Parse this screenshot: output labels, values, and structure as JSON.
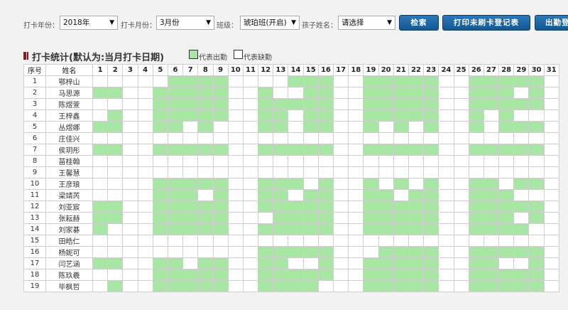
{
  "filters": {
    "year_label": "打卡年份：",
    "year_value": "2018年",
    "month_label": "打卡月份：",
    "month_value": "3月份",
    "class_label": "班级：",
    "class_value": "琥珀班(开启)",
    "child_label": "孩子姓名：",
    "child_value": "请选择",
    "search_button": "检索",
    "print_button": "打印未刷卡登记表",
    "export_button": "出勤登记"
  },
  "section": {
    "title": "打卡统计(默认为:当月打卡日期)",
    "legend_present": "代表出勤",
    "legend_absent": "代表缺勤",
    "colors": {
      "present": "#a8e6a3",
      "absent": "#ffffff",
      "title_mark": "#8b1a1a",
      "button": "#1e6aa8"
    }
  },
  "table": {
    "seq_header": "序号",
    "name_header": "姓名",
    "days": [
      "1",
      "2",
      "3",
      "4",
      "5",
      "6",
      "7",
      "8",
      "9",
      "10",
      "11",
      "12",
      "13",
      "14",
      "15",
      "16",
      "17",
      "18",
      "19",
      "20",
      "21",
      "22",
      "23",
      "24",
      "25",
      "26",
      "27",
      "28",
      "29",
      "30",
      "31"
    ],
    "rows": [
      {
        "seq": "1",
        "name": "鄂梓山",
        "present": [
          6,
          7,
          8,
          9,
          14,
          15,
          16,
          19,
          20,
          21,
          22,
          23,
          26,
          27,
          28,
          29,
          30
        ]
      },
      {
        "seq": "2",
        "name": "马思源",
        "present": [
          1,
          2,
          5,
          6,
          7,
          8,
          9,
          12,
          15,
          16,
          19,
          20,
          21,
          22,
          23,
          26,
          27,
          28,
          30
        ]
      },
      {
        "seq": "3",
        "name": "陈煜萱",
        "present": [
          5,
          6,
          7,
          8,
          9,
          12,
          13,
          14,
          15,
          16,
          19,
          20,
          21,
          22,
          23,
          26,
          27,
          28,
          29,
          30
        ]
      },
      {
        "seq": "4",
        "name": "王梓鑫",
        "present": [
          2,
          5,
          6,
          7,
          8,
          9,
          12,
          13,
          15,
          16,
          19,
          20,
          21,
          22,
          23,
          26,
          28
        ]
      },
      {
        "seq": "5",
        "name": "丛煜娜",
        "present": [
          1,
          2,
          5,
          6,
          8,
          12,
          13,
          15,
          16,
          19,
          21,
          23,
          26,
          28,
          29,
          30
        ]
      },
      {
        "seq": "6",
        "name": "庄佳兴",
        "present": []
      },
      {
        "seq": "7",
        "name": "侯玥彤",
        "present": [
          1,
          2,
          5,
          6,
          7,
          8,
          9,
          12,
          13,
          14,
          15,
          16,
          19,
          20,
          21,
          22,
          23,
          26,
          27,
          28,
          29,
          30
        ]
      },
      {
        "seq": "8",
        "name": "苗桂翰",
        "present": []
      },
      {
        "seq": "9",
        "name": "王馨慧",
        "present": []
      },
      {
        "seq": "10",
        "name": "王彦琅",
        "present": [
          5,
          6,
          7,
          8,
          9,
          12,
          13,
          14,
          16,
          19,
          21,
          23,
          26,
          27,
          29,
          30
        ]
      },
      {
        "seq": "11",
        "name": "梁靖芮",
        "present": [
          5,
          6,
          7,
          9,
          12,
          13,
          15,
          16,
          19,
          20,
          22,
          23,
          26,
          27,
          28
        ]
      },
      {
        "seq": "12",
        "name": "刘亚宸",
        "present": [
          1,
          2,
          5,
          6,
          7,
          8,
          9,
          12,
          13,
          14,
          15,
          16,
          19,
          20,
          21,
          22,
          23,
          26,
          27,
          28,
          29,
          30
        ]
      },
      {
        "seq": "13",
        "name": "张耘赫",
        "present": [
          1,
          2,
          5,
          6,
          7,
          8,
          9,
          13,
          14,
          15,
          16,
          19,
          20,
          21,
          22,
          23,
          26,
          27,
          28,
          30
        ]
      },
      {
        "seq": "14",
        "name": "刘家碁",
        "present": [
          1,
          5,
          6,
          7,
          8,
          9,
          12,
          13,
          14,
          15,
          16,
          19,
          20,
          21,
          22,
          23,
          26,
          27,
          28,
          29
        ]
      },
      {
        "seq": "15",
        "name": "田皓仁",
        "present": []
      },
      {
        "seq": "16",
        "name": "杨妮可",
        "present": [
          12,
          13,
          14,
          15,
          16,
          20,
          21,
          22,
          23,
          26,
          27,
          28,
          29,
          30
        ]
      },
      {
        "seq": "17",
        "name": "闫艺涵",
        "present": [
          1,
          2,
          5,
          6,
          8,
          9,
          12,
          13,
          16,
          19,
          20,
          21,
          22,
          23,
          26,
          27,
          30
        ]
      },
      {
        "seq": "18",
        "name": "陈玖羲",
        "present": [
          5,
          6,
          7,
          8,
          9,
          12,
          13,
          14,
          15,
          16,
          19,
          20,
          21,
          22,
          23,
          26,
          27,
          28,
          29,
          30
        ]
      },
      {
        "seq": "19",
        "name": "毕枫哲",
        "present": [
          2,
          5,
          6,
          7,
          8,
          9,
          12,
          13,
          14,
          15,
          19,
          20,
          21,
          22,
          23,
          26,
          27,
          28,
          29,
          30
        ]
      }
    ]
  }
}
